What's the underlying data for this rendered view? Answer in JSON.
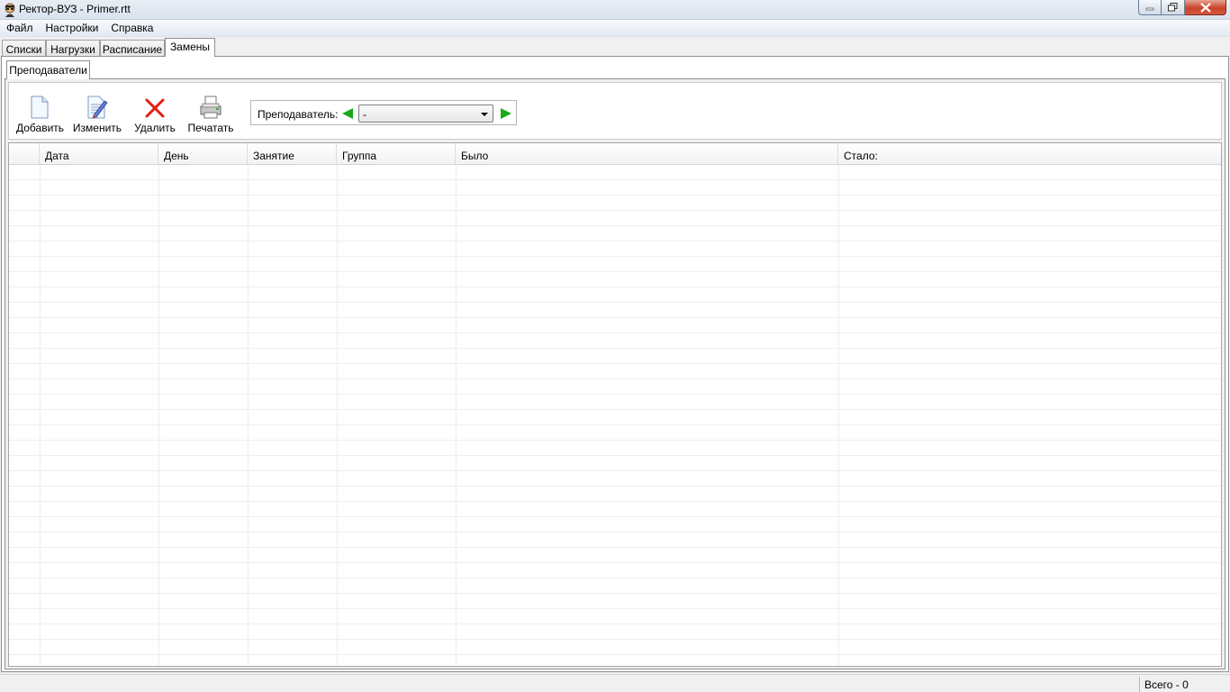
{
  "window": {
    "title": "Ректор-ВУЗ - Primer.rtt"
  },
  "menu": [
    "Файл",
    "Настройки",
    "Справка"
  ],
  "tabs": [
    "Списки",
    "Нагрузки",
    "Расписание",
    "Замены"
  ],
  "active_tab": "Замены",
  "subtabs": [
    "Преподаватели"
  ],
  "toolbar": {
    "add": "Добавить",
    "edit": "Изменить",
    "delete": "Удалить",
    "print": "Печатать"
  },
  "filter": {
    "label": "Преподаватель:",
    "value": "-"
  },
  "table": {
    "columns": [
      "Дата",
      "День",
      "Занятие",
      "Группа",
      "Было",
      "Стало:"
    ],
    "rows": []
  },
  "status": {
    "total": "Всего - 0"
  },
  "colors": {
    "arrow": "#1aaa1a",
    "delete": "#e02010"
  }
}
